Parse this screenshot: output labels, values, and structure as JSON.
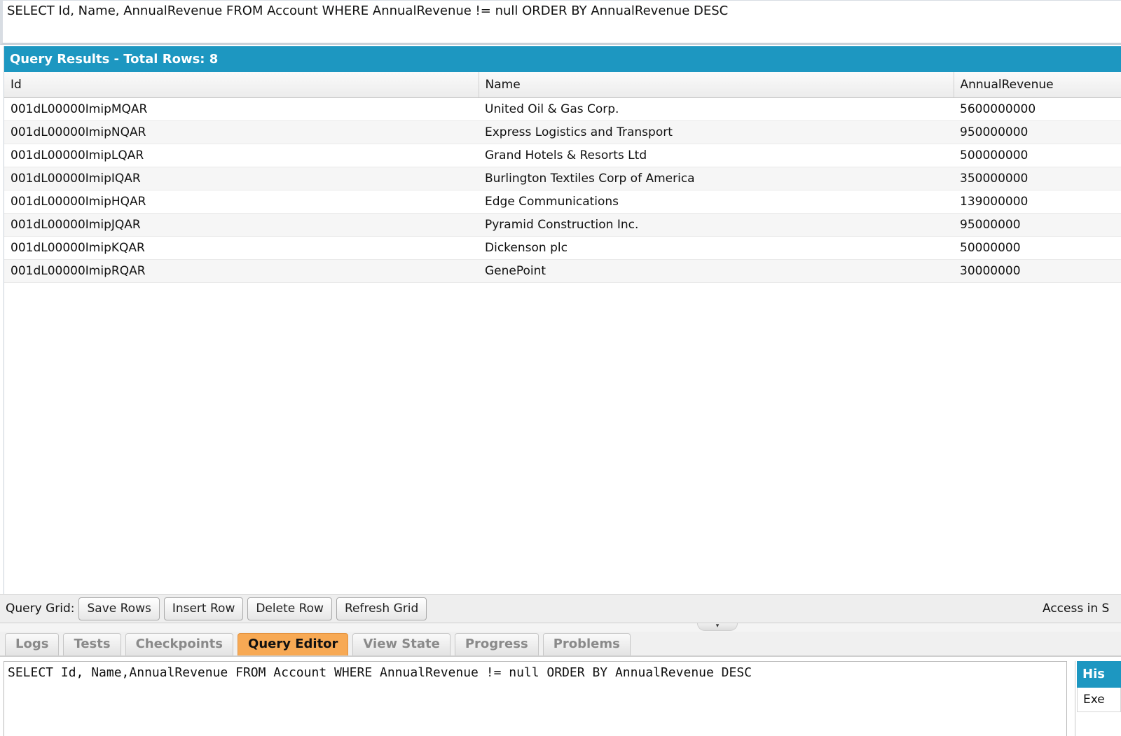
{
  "executed_query": "SELECT Id, Name, AnnualRevenue FROM Account WHERE AnnualRevenue != null ORDER BY AnnualRevenue DESC",
  "results": {
    "header": "Query Results - Total Rows: 8",
    "columns": [
      "Id",
      "Name",
      "AnnualRevenue"
    ],
    "rows": [
      {
        "id": "001dL00000ImipMQAR",
        "name": "United Oil & Gas Corp.",
        "revenue": "5600000000"
      },
      {
        "id": "001dL00000ImipNQAR",
        "name": "Express Logistics and Transport",
        "revenue": "950000000"
      },
      {
        "id": "001dL00000ImipLQAR",
        "name": "Grand Hotels & Resorts Ltd",
        "revenue": "500000000"
      },
      {
        "id": "001dL00000ImipIQAR",
        "name": "Burlington Textiles Corp of America",
        "revenue": "350000000"
      },
      {
        "id": "001dL00000ImipHQAR",
        "name": "Edge Communications",
        "revenue": "139000000"
      },
      {
        "id": "001dL00000ImipJQAR",
        "name": "Pyramid Construction Inc.",
        "revenue": "95000000"
      },
      {
        "id": "001dL00000ImipKQAR",
        "name": "Dickenson plc",
        "revenue": "50000000"
      },
      {
        "id": "001dL00000ImipRQAR",
        "name": "GenePoint",
        "revenue": "30000000"
      }
    ]
  },
  "toolbar": {
    "label": "Query Grid:",
    "save_rows": "Save Rows",
    "insert_row": "Insert Row",
    "delete_row": "Delete Row",
    "refresh_grid": "Refresh Grid",
    "right_note": "Access in S"
  },
  "splitter": {
    "icon": "chevron-down-icon",
    "glyph": "▾"
  },
  "tabs": [
    {
      "label": "Logs",
      "active": false
    },
    {
      "label": "Tests",
      "active": false
    },
    {
      "label": "Checkpoints",
      "active": false
    },
    {
      "label": "Query Editor",
      "active": true
    },
    {
      "label": "View State",
      "active": false
    },
    {
      "label": "Progress",
      "active": false
    },
    {
      "label": "Problems",
      "active": false
    }
  ],
  "editor": {
    "text": "SELECT Id, Name,AnnualRevenue FROM Account WHERE AnnualRevenue != null ORDER BY AnnualRevenue DESC"
  },
  "history": {
    "header": "His",
    "item": "Exe"
  },
  "colors": {
    "accent_blue": "#1d97c1",
    "active_tab": "#f7a954"
  }
}
